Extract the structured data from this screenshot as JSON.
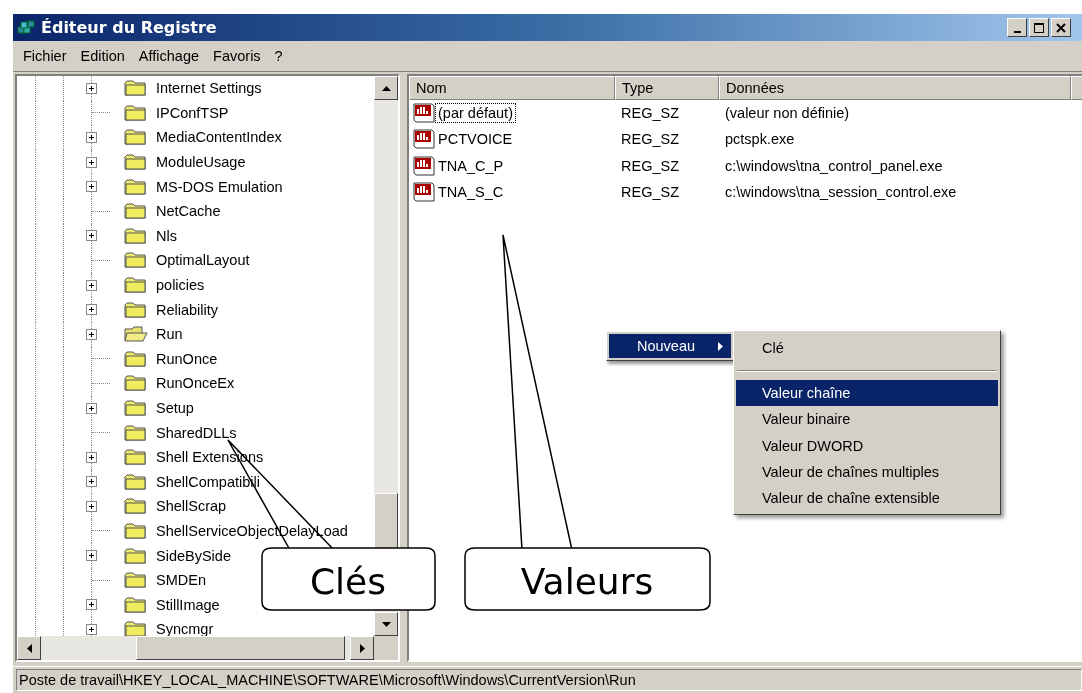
{
  "window": {
    "title": "Éditeur du Registre"
  },
  "menu": [
    "Fichier",
    "Edition",
    "Affichage",
    "Favoris",
    "?"
  ],
  "tree": {
    "items": [
      {
        "label": "Internet Settings",
        "expandable": true,
        "open": false
      },
      {
        "label": "IPConfTSP",
        "expandable": false,
        "open": false
      },
      {
        "label": "MediaContentIndex",
        "expandable": true,
        "open": false
      },
      {
        "label": "ModuleUsage",
        "expandable": true,
        "open": false
      },
      {
        "label": "MS-DOS Emulation",
        "expandable": true,
        "open": false
      },
      {
        "label": "NetCache",
        "expandable": false,
        "open": false
      },
      {
        "label": "Nls",
        "expandable": true,
        "open": false
      },
      {
        "label": "OptimalLayout",
        "expandable": false,
        "open": false
      },
      {
        "label": "policies",
        "expandable": true,
        "open": false
      },
      {
        "label": "Reliability",
        "expandable": true,
        "open": false
      },
      {
        "label": "Run",
        "expandable": true,
        "open": true
      },
      {
        "label": "RunOnce",
        "expandable": false,
        "open": false
      },
      {
        "label": "RunOnceEx",
        "expandable": false,
        "open": false
      },
      {
        "label": "Setup",
        "expandable": true,
        "open": false
      },
      {
        "label": "SharedDLLs",
        "expandable": false,
        "open": false
      },
      {
        "label": "Shell Extensions",
        "expandable": true,
        "open": false
      },
      {
        "label": "ShellCompatibili",
        "expandable": true,
        "open": false
      },
      {
        "label": "ShellScrap",
        "expandable": true,
        "open": false
      },
      {
        "label": "ShellServiceObjectDelayLoad",
        "expandable": false,
        "open": false
      },
      {
        "label": "SideBySide",
        "expandable": true,
        "open": false
      },
      {
        "label": "SMDEn",
        "expandable": false,
        "open": false
      },
      {
        "label": "StillImage",
        "expandable": true,
        "open": false
      },
      {
        "label": "Syncmgr",
        "expandable": true,
        "open": false
      }
    ]
  },
  "values": {
    "columns": [
      "Nom",
      "Type",
      "Données"
    ],
    "rows": [
      {
        "name": "(par défaut)",
        "type": "REG_SZ",
        "data": "(valeur non définie)",
        "focused": true
      },
      {
        "name": "PCTVOICE",
        "type": "REG_SZ",
        "data": "pctspk.exe",
        "focused": false
      },
      {
        "name": "TNA_C_P",
        "type": "REG_SZ",
        "data": "c:\\windows\\tna_control_panel.exe",
        "focused": false
      },
      {
        "name": "TNA_S_C",
        "type": "REG_SZ",
        "data": "c:\\windows\\tna_session_control.exe",
        "focused": false
      }
    ]
  },
  "context_menu": {
    "items": [
      {
        "label": "Nouveau",
        "selected": true
      }
    ],
    "submenu": [
      {
        "kind": "item",
        "label": "Clé",
        "selected": false
      },
      {
        "kind": "separator"
      },
      {
        "kind": "item",
        "label": "Valeur chaîne",
        "selected": true
      },
      {
        "kind": "item",
        "label": "Valeur binaire",
        "selected": false
      },
      {
        "kind": "item",
        "label": "Valeur DWORD",
        "selected": false
      },
      {
        "kind": "item",
        "label": "Valeur de chaînes multiples",
        "selected": false
      },
      {
        "kind": "item",
        "label": "Valeur de chaîne extensible",
        "selected": false
      }
    ]
  },
  "callouts": [
    "Clés",
    "Valeurs"
  ],
  "status_bar": "Poste de travail\\HKEY_LOCAL_MACHINE\\SOFTWARE\\Microsoft\\Windows\\CurrentVersion\\Run"
}
